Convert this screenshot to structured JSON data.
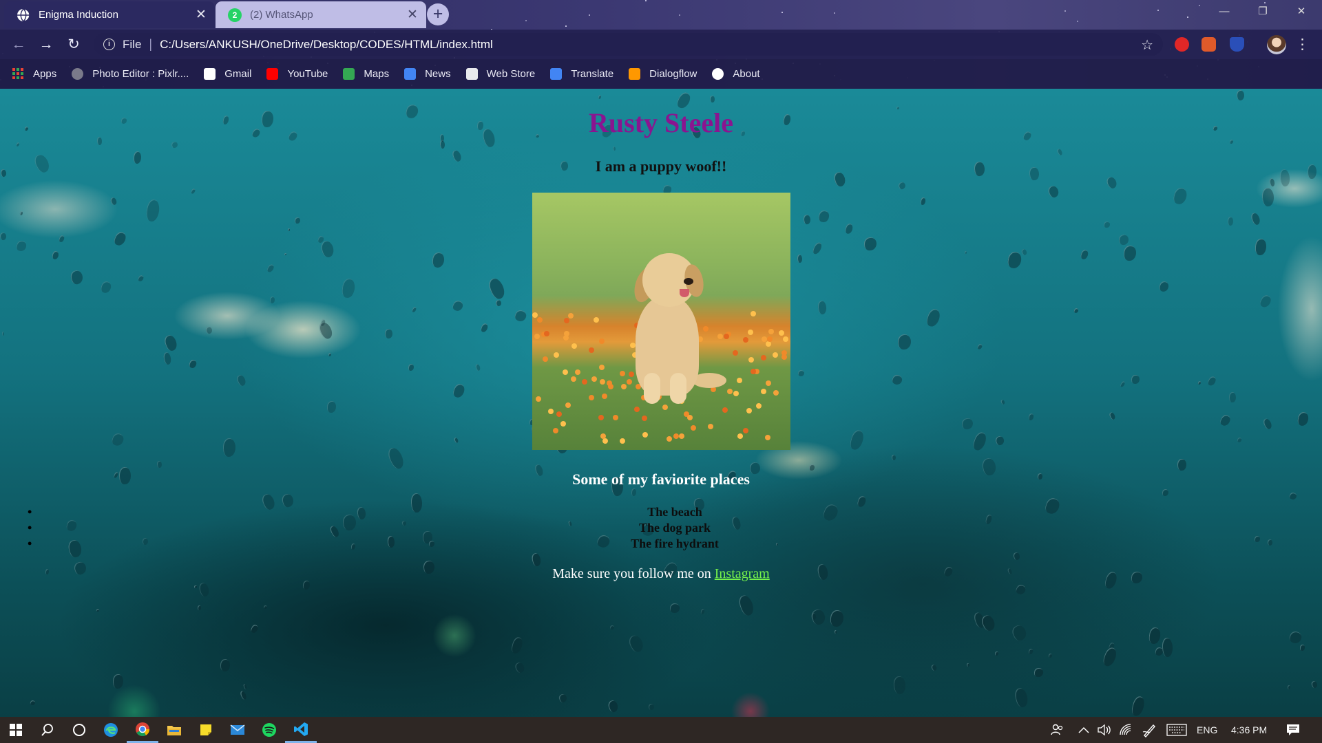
{
  "browser": {
    "tabs": [
      {
        "title": "Enigma Induction",
        "active": true,
        "favicon": "globe-icon"
      },
      {
        "title": "(2) WhatsApp",
        "active": false,
        "favicon": "whatsapp-icon",
        "badge": "2"
      }
    ],
    "new_tab_glyph": "+",
    "window_controls": {
      "minimize": "—",
      "maximize": "❐",
      "close": "✕"
    },
    "nav": {
      "back": "←",
      "forward": "→",
      "reload": "↻"
    },
    "address": {
      "scheme_label": "File",
      "separator": "|",
      "url": "C:/Users/ANKUSH/OneDrive/Desktop/CODES/HTML/index.html",
      "info_glyph": "i",
      "star_glyph": "☆"
    },
    "menu_glyph": "⋮",
    "bookmarks": [
      {
        "label": "Apps",
        "icon": "apps-grid-icon",
        "color": "#ea4335"
      },
      {
        "label": "Photo Editor : Pixlr....",
        "icon": "pixlr-icon",
        "color": "#7a7a8a"
      },
      {
        "label": "Gmail",
        "icon": "gmail-icon",
        "color": "#ffffff"
      },
      {
        "label": "YouTube",
        "icon": "youtube-icon",
        "color": "#ff0000"
      },
      {
        "label": "Maps",
        "icon": "maps-icon",
        "color": "#34a853"
      },
      {
        "label": "News",
        "icon": "news-icon",
        "color": "#4285f4"
      },
      {
        "label": "Web Store",
        "icon": "webstore-icon",
        "color": "#e8eaed"
      },
      {
        "label": "Translate",
        "icon": "translate-icon",
        "color": "#4285f4"
      },
      {
        "label": "Dialogflow",
        "icon": "dialogflow-icon",
        "color": "#ff9800"
      },
      {
        "label": "About",
        "icon": "chrome-about-icon",
        "color": "#ffffff"
      }
    ]
  },
  "page": {
    "name": "Rusty Steele",
    "tagline": "I am a puppy woof!!",
    "photo_icon": "puppy-photo",
    "places_heading": "Some of my faviorite places",
    "places": [
      "The beach",
      "The dog park",
      "The fire hydrant"
    ],
    "follow_text": "Make sure you follow me on ",
    "follow_link": "Instagram",
    "colors": {
      "name": "#8a1590",
      "link": "#74f04b"
    }
  },
  "taskbar": {
    "apps": [
      "windows-start-icon",
      "search-icon",
      "cortana-icon",
      "edge-icon",
      "chrome-icon",
      "file-explorer-icon",
      "sticky-notes-icon",
      "mail-icon",
      "spotify-icon",
      "vscode-icon"
    ],
    "language": "ENG",
    "time": "4:36 PM"
  }
}
